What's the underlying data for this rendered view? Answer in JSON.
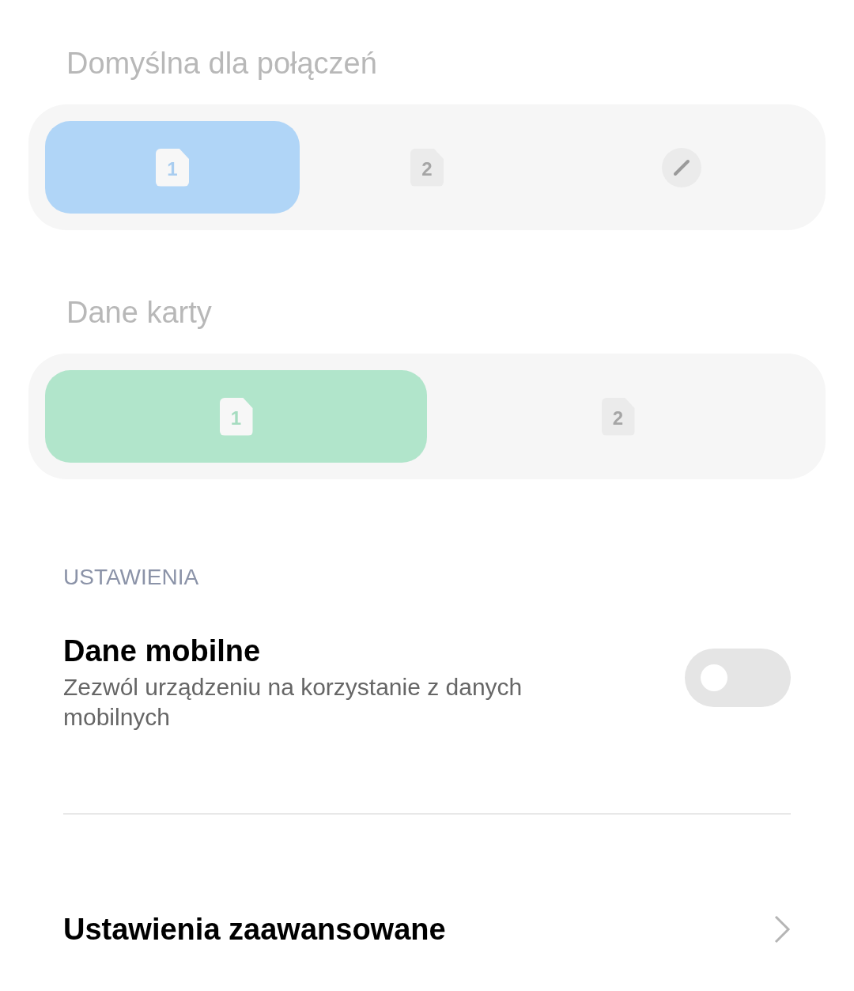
{
  "sim_groups": [
    {
      "title": "Domyślna dla połączeń",
      "kind": "calls",
      "options": [
        {
          "kind": "sim",
          "label": "1",
          "selected": true
        },
        {
          "kind": "sim",
          "label": "2",
          "selected": false
        },
        {
          "kind": "edit",
          "selected": false
        }
      ]
    },
    {
      "title": "Dane karty",
      "kind": "data",
      "options": [
        {
          "kind": "sim",
          "label": "1",
          "selected": true
        },
        {
          "kind": "sim",
          "label": "2",
          "selected": false
        }
      ]
    }
  ],
  "section_header": "USTAWIENIA",
  "mobile_data": {
    "title": "Dane mobilne",
    "description": "Zezwól urządzeniu na korzystanie z danych mobilnych",
    "on": false
  },
  "advanced": {
    "title": "Ustawienia zaawansowane"
  }
}
